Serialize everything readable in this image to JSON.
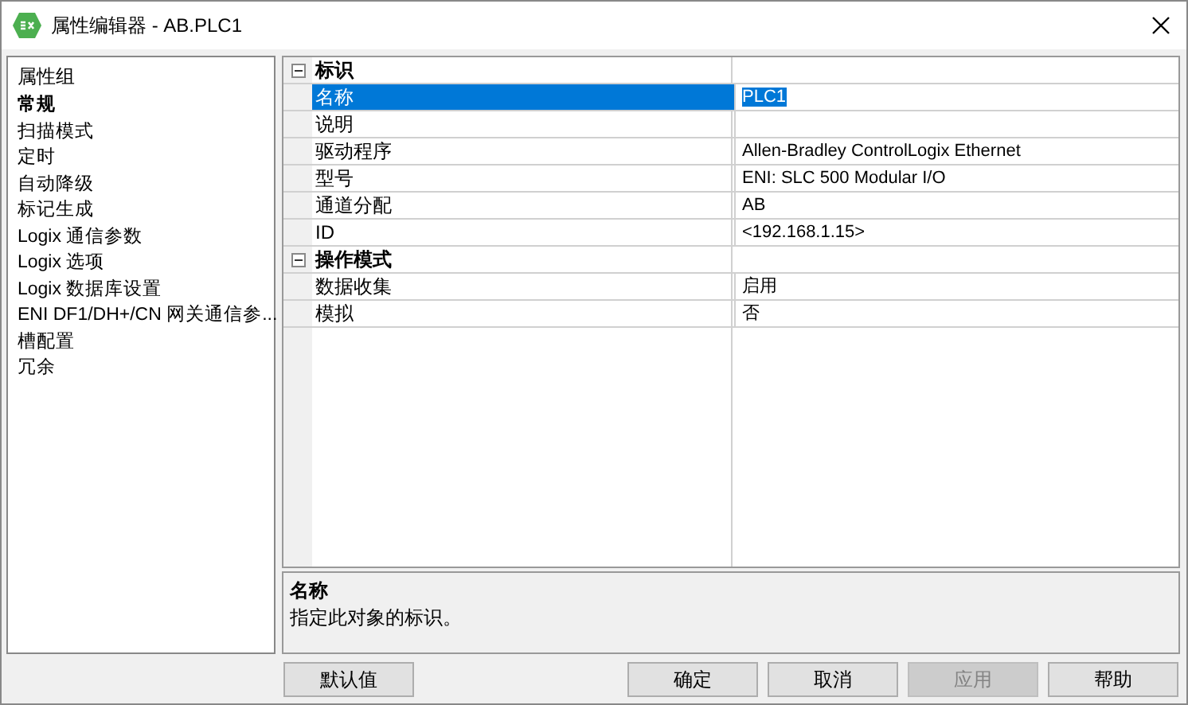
{
  "window": {
    "title": "属性编辑器 - AB.PLC1"
  },
  "sidebar": {
    "heading": "属性组",
    "items": [
      {
        "label": "常规",
        "selected": true
      },
      {
        "label": "扫描模式",
        "selected": false
      },
      {
        "label": "定时",
        "selected": false
      },
      {
        "label": "自动降级",
        "selected": false
      },
      {
        "label": "标记生成",
        "selected": false
      },
      {
        "label": "Logix 通信参数",
        "selected": false
      },
      {
        "label": "Logix 选项",
        "selected": false
      },
      {
        "label": "Logix 数据库设置",
        "selected": false
      },
      {
        "label": "ENI DF1/DH+/CN 网关通信参...",
        "selected": false
      },
      {
        "label": "槽配置",
        "selected": false
      },
      {
        "label": "冗余",
        "selected": false
      }
    ]
  },
  "grid": {
    "groups": [
      {
        "title": "标识",
        "expanded": true,
        "properties": [
          {
            "name": "名称",
            "value": "PLC1",
            "selected": true
          },
          {
            "name": "说明",
            "selected": false
          },
          {
            "name": "驱动程序",
            "value": "Allen-Bradley ControlLogix Ethernet",
            "selected": false
          },
          {
            "name": "型号",
            "value": "ENI: SLC 500 Modular I/O",
            "selected": false
          },
          {
            "name": "通道分配",
            "value": "AB",
            "selected": false
          },
          {
            "name": "ID",
            "value": "<192.168.1.15>",
            "selected": false
          }
        ]
      },
      {
        "title": "操作模式",
        "expanded": true,
        "properties": [
          {
            "name": "数据收集",
            "value": "启用",
            "selected": false
          },
          {
            "name": "模拟",
            "value": "否",
            "selected": false
          }
        ]
      }
    ]
  },
  "description": {
    "title": "名称",
    "text": "指定此对象的标识。"
  },
  "left_buttons": [
    {
      "label": "默认值",
      "disabled": false
    }
  ],
  "right_buttons": [
    {
      "label": "确定",
      "disabled": false
    },
    {
      "label": "取消",
      "disabled": false
    },
    {
      "label": "应用",
      "disabled": true
    },
    {
      "label": "帮助",
      "disabled": false
    }
  ]
}
